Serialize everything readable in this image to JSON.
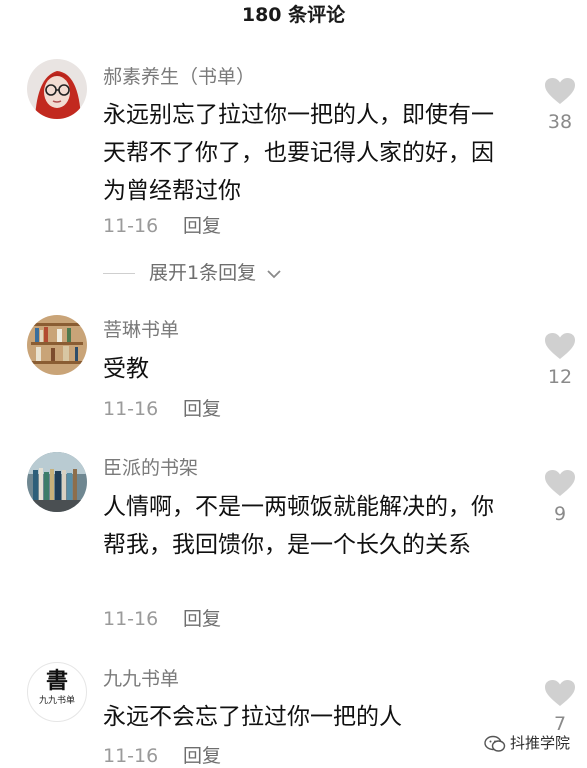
{
  "header": {
    "title": "180 条评论"
  },
  "comments": [
    {
      "username": "郝素养生（书单）",
      "text": "永远别忘了拉过你一把的人，即使有一天帮不了你了，也要记得人家的好，因为曾经帮过你",
      "date": "11-16",
      "reply_label": "回复",
      "likes": "38"
    },
    {
      "username": "菩琳书单",
      "text": "受教",
      "date": "11-16",
      "reply_label": "回复",
      "likes": "12"
    },
    {
      "username": "臣派的书架",
      "text": "人情啊，不是一两顿饭就能解决的，你帮我，我回馈你，是一个长久的关系",
      "date": "11-16",
      "reply_label": "回复",
      "likes": "9"
    },
    {
      "username": "九九书单",
      "text": "永远不会忘了拉过你一把的人",
      "date": "11-16",
      "reply_label": "回复",
      "likes": "7",
      "avatar_text": "書",
      "avatar_subtext": "九九书单"
    }
  ],
  "expand_replies": {
    "label": "展开1条回复"
  },
  "watermark": {
    "text": "抖推学院"
  },
  "colors": {
    "username": "#7a7a7a",
    "text": "#111111",
    "meta": "#9a9a9a",
    "heart": "#d0d0d0"
  },
  "icons": {
    "like": "heart-icon",
    "expand": "chevron-down-icon",
    "watermark": "wechat-icon"
  }
}
